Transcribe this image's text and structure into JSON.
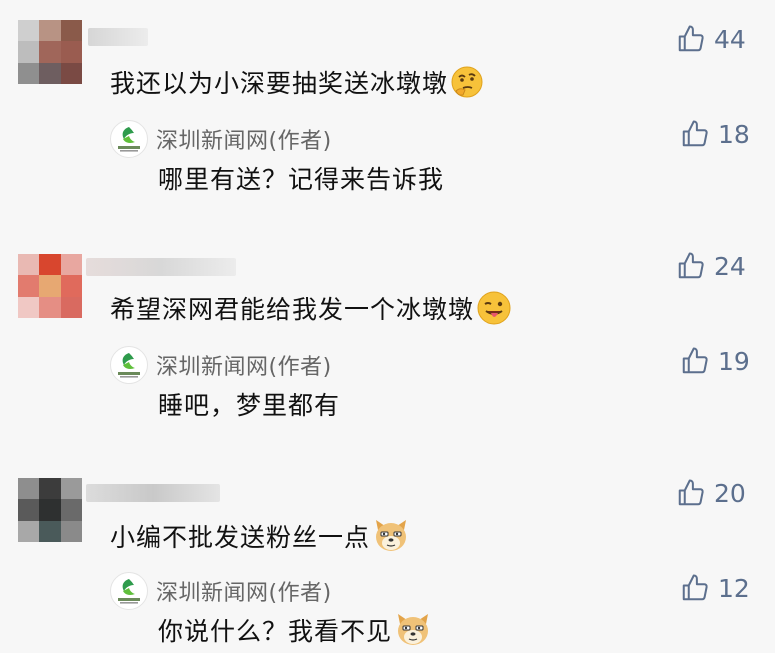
{
  "comments": [
    {
      "text": "我还以为小深要抽奖送冰墩墩",
      "emoji": "thinking-face-emoji",
      "likes": "44",
      "reply": {
        "author": "深圳新闻网(作者)",
        "text": "哪里有送？记得来告诉我",
        "likes": "18"
      }
    },
    {
      "text": "希望深网君能给我发一个冰墩墩",
      "emoji": "winking-tongue-face-emoji",
      "likes": "24",
      "reply": {
        "author": "深圳新闻网(作者)",
        "text": "睡吧，梦里都有",
        "likes": "19"
      }
    },
    {
      "text": "小编不批发送粉丝一点",
      "emoji": "doge-emoji",
      "likes": "20",
      "reply": {
        "author": "深圳新闻网(作者)",
        "text": "你说什么？我看不见",
        "likes": "12"
      }
    }
  ],
  "colors": {
    "like": "#5c6f8d",
    "author": "#666666",
    "background": "#f7f7f7"
  }
}
